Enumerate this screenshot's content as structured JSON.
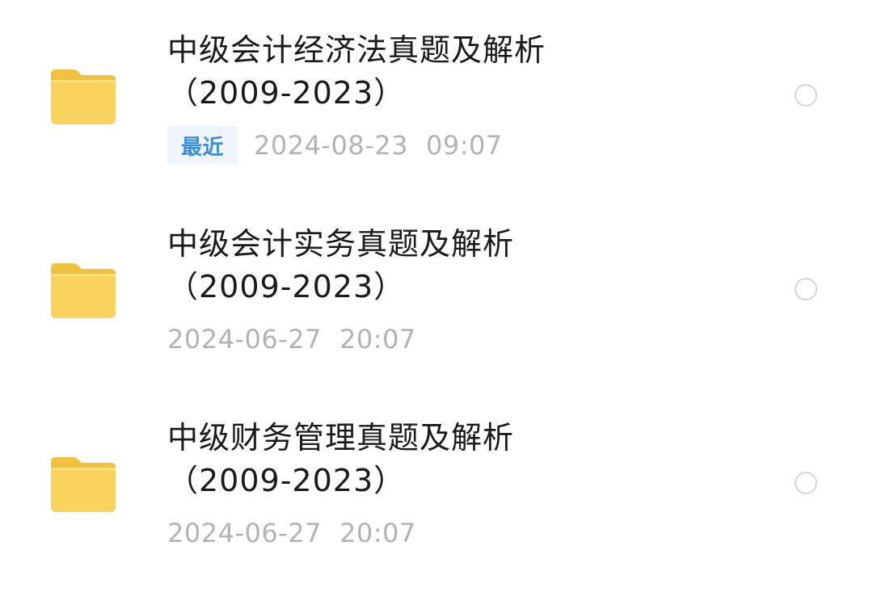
{
  "files": [
    {
      "name_line1": "中级会计经济法真题及解析",
      "name_line2": "（2009-2023）",
      "tag": "最近",
      "date": "2024-08-23",
      "time": "09:07",
      "icon": "folder-icon",
      "selected": false
    },
    {
      "name_line1": "中级会计实务真题及解析",
      "name_line2": "（2009-2023）",
      "date": "2024-06-27",
      "time": "20:07",
      "icon": "folder-icon",
      "selected": false
    },
    {
      "name_line1": "中级财务管理真题及解析",
      "name_line2": "（2009-2023）",
      "date": "2024-06-27",
      "time": "20:07",
      "icon": "folder-icon",
      "selected": false
    }
  ],
  "colors": {
    "background": "#ffffff",
    "title_text": "#1a1a1a",
    "meta_text": "#b3b3b3",
    "tag_text": "#3b8fd6",
    "tag_background": "#eef5fb",
    "folder": "#f8d35e",
    "radio_border": "#d6d6d6"
  }
}
